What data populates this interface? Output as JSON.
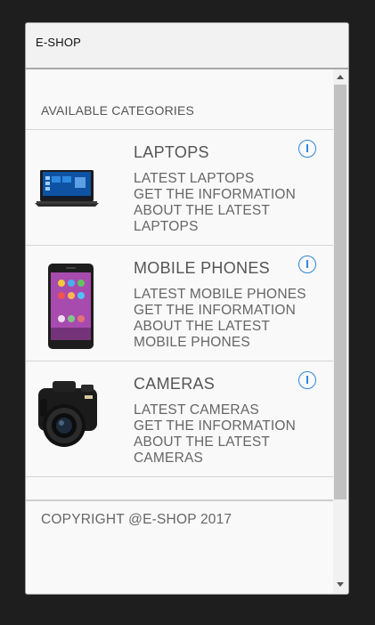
{
  "app": {
    "title": "E-SHOP"
  },
  "main": {
    "heading": "AVAILABLE CATEGORIES",
    "categories": [
      {
        "title": "LAPTOPS",
        "subtitle": "LATEST LAPTOPS",
        "description": "GET THE INFORMATION ABOUT THE LATEST LAPTOPS",
        "image": "laptop-image",
        "action_icon": "info-icon"
      },
      {
        "title": "MOBILE PHONES",
        "subtitle": "LATEST MOBILE PHONES",
        "description": "GET THE INFORMATION ABOUT THE LATEST MOBILE PHONES",
        "image": "phone-image",
        "action_icon": "info-icon"
      },
      {
        "title": "CAMERAS",
        "subtitle": "LATEST CAMERAS",
        "description": "GET THE INFORMATION ABOUT THE LATEST CAMERAS",
        "image": "camera-image",
        "action_icon": "info-icon"
      }
    ],
    "footer": "COPYRIGHT @E-SHOP 2017"
  },
  "colors": {
    "accent": "#2f86d9",
    "background": "#1e1e1e",
    "text": "#666666"
  }
}
